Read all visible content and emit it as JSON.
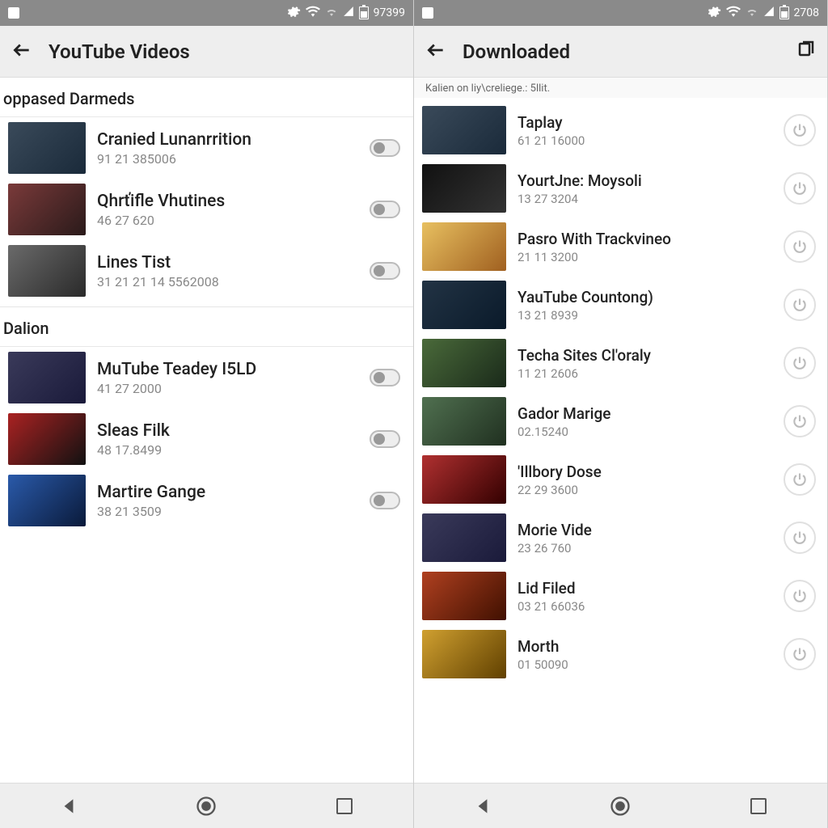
{
  "left": {
    "status_time": "97399",
    "app_title": "YouTube Videos",
    "sections": [
      {
        "header": "oppased Darmeds",
        "items": [
          {
            "title": "Cranied Lunanrrition",
            "meta": "91 21 385006",
            "thumb": "th0"
          },
          {
            "title": "Qhrťifle Vhutines",
            "meta": "46 27 620",
            "thumb": "th1"
          },
          {
            "title": "Lines Tist",
            "meta": "31 21 21 14 5562008",
            "thumb": "th2"
          }
        ]
      },
      {
        "header": "Dalion",
        "items": [
          {
            "title": "MuTube Teadey I5LD",
            "meta": "41 27 2000",
            "thumb": "th3"
          },
          {
            "title": "Sleas Filk",
            "meta": "48 17.8499",
            "thumb": "th4"
          },
          {
            "title": "Martire Gange",
            "meta": "38 21 3509",
            "thumb": "th5"
          }
        ]
      }
    ]
  },
  "right": {
    "status_time": "2708",
    "app_title": "Downloaded",
    "sub_header": "Kalien on liy\\creliege.: 5llit.",
    "items": [
      {
        "title": "Taplay",
        "meta": "61 21 16000",
        "thumb": "th0"
      },
      {
        "title": "YourtJne: Moysoli",
        "meta": "13 27 3204",
        "thumb": "th8"
      },
      {
        "title": "Pasro With Trackvineo",
        "meta": "21 11 3200",
        "thumb": "th6"
      },
      {
        "title": "YauTube Countong)",
        "meta": "13 21 8939",
        "thumb": "th13"
      },
      {
        "title": "Techa Sites Cl'oraly",
        "meta": "11 21 2606",
        "thumb": "th7"
      },
      {
        "title": "Gador Marige",
        "meta": "02.15240",
        "thumb": "th10"
      },
      {
        "title": "'Illbory Dose",
        "meta": "22 29 3600",
        "thumb": "th9"
      },
      {
        "title": "Morie Vide",
        "meta": "23 26 760",
        "thumb": "th3"
      },
      {
        "title": "Lid Filed",
        "meta": "03 21 66036",
        "thumb": "th11"
      },
      {
        "title": "Morth",
        "meta": "01 50090",
        "thumb": "th12"
      }
    ]
  }
}
